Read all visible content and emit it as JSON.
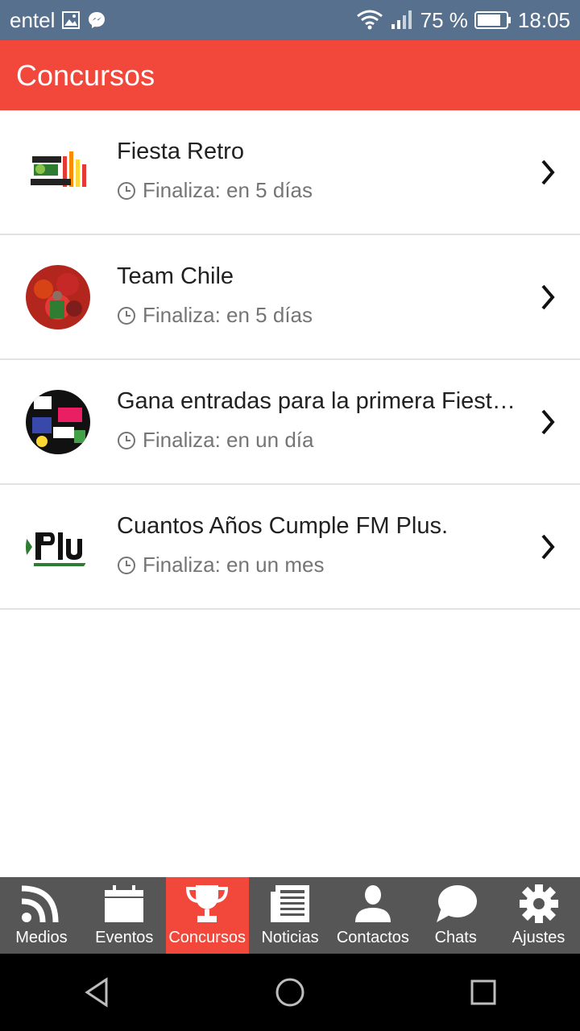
{
  "status": {
    "carrier": "entel",
    "battery": "75 %",
    "time": "18:05"
  },
  "header": {
    "title": "Concursos"
  },
  "contests": [
    {
      "title": "Fiesta Retro",
      "ends": "Finaliza: en 5 días"
    },
    {
      "title": "Team Chile",
      "ends": "Finaliza: en 5 días"
    },
    {
      "title": "Gana entradas para la primera Fiesta…",
      "ends": "Finaliza: en un día"
    },
    {
      "title": "Cuantos Años Cumple FM Plus.",
      "ends": "Finaliza: en un mes"
    }
  ],
  "nav": {
    "active": "Concursos",
    "tabs": [
      "Medios",
      "Eventos",
      "Concursos",
      "Noticias",
      "Contactos",
      "Chats",
      "Ajustes"
    ]
  },
  "colors": {
    "accent": "#f2473b",
    "status_bar": "#56708d",
    "nav_bg": "#565656"
  }
}
